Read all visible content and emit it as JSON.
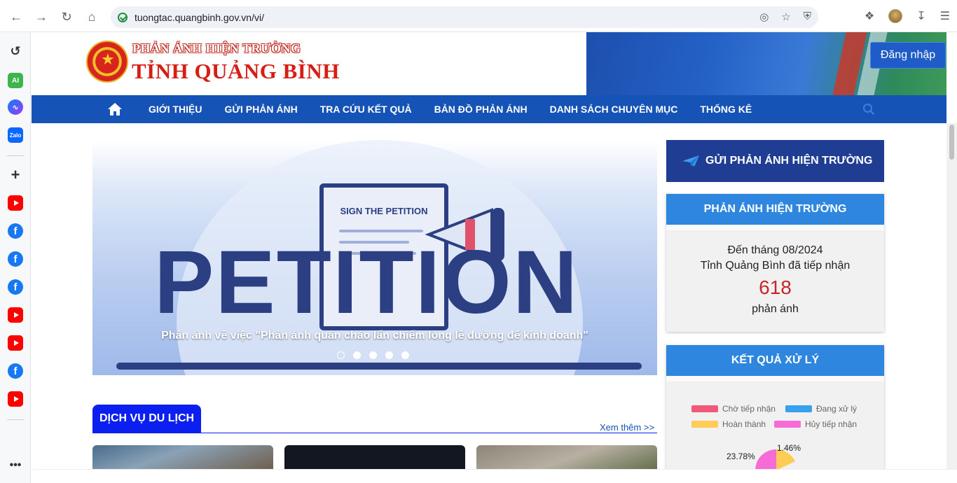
{
  "browser": {
    "url": "tuongtac.quangbinh.gov.vn/vi/"
  },
  "header": {
    "logo_sub": "PHẢN ÁNH HIỆN TRƯỜNG",
    "logo_main": "TỈNH QUẢNG BÌNH",
    "login_label": "Đăng nhập"
  },
  "nav": {
    "items": [
      "GIỚI THIỆU",
      "GỬI PHẢN ÁNH",
      "TRA CỨU KẾT QUẢ",
      "BẢN ĐỒ PHẢN ÁNH",
      "DANH SÁCH CHUYÊN MỤC",
      "THỐNG KÊ"
    ]
  },
  "slider": {
    "board_title": "SIGN THE PETITION",
    "big_word": "PETITION",
    "caption": "Phản ánh về việc \"Phản ánh quán cháo lấn chiếm lòng lề đường để kinh doanh\"",
    "dot_count": 5,
    "active_dot": 0
  },
  "section": {
    "title": "DỊCH VỤ DU LỊCH",
    "see_more": "Xem thêm >>"
  },
  "right": {
    "send_label": "GỬI PHẢN ÁNH HIỆN TRƯỜNG",
    "stats": {
      "title": "PHẢN ÁNH HIỆN TRƯỜNG",
      "line1": "Đến tháng 08/2024",
      "line2": "Tỉnh Quảng Bình đã tiếp nhận",
      "count": "618",
      "unit": "phản ánh"
    },
    "results": {
      "title": "KẾT QUẢ XỬ LÝ",
      "legend": [
        {
          "label": "Chờ tiếp nhận",
          "color": "#f05a78"
        },
        {
          "label": "Đang xử lý",
          "color": "#36a2eb"
        },
        {
          "label": "Hoàn thành",
          "color": "#ffcd56"
        },
        {
          "label": "Hủy tiếp nhận",
          "color": "#f66bd5"
        }
      ],
      "pct_left": "23.78%",
      "pct_right": "1.46%"
    }
  },
  "colors": {
    "nav": "#1553b6",
    "accent_red": "#d81e14",
    "section_blue": "#0a1ff0"
  }
}
